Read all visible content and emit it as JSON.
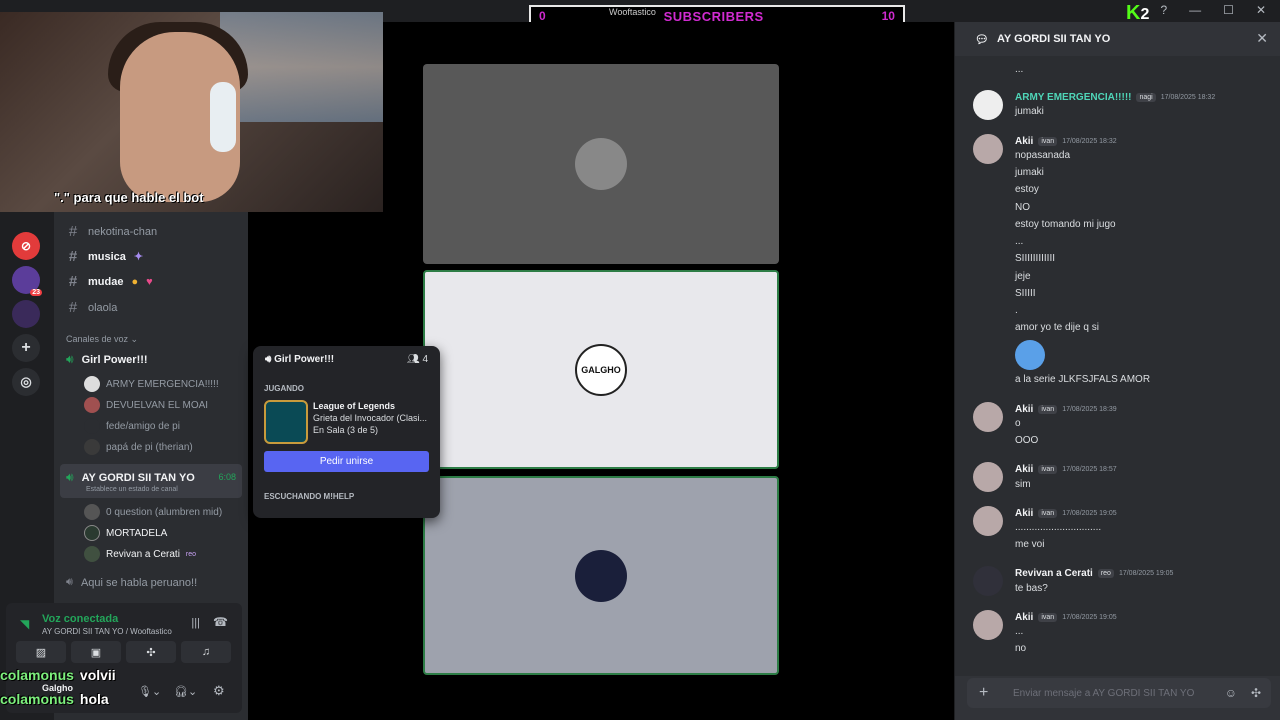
{
  "top": {
    "subs_left": "0",
    "subs_label": "SUBSCRIBERS",
    "subs_right": "10",
    "subs_user": "Wooftastico",
    "kick_count": "2"
  },
  "webcam": {
    "caption": "\".\" para que hable el bot"
  },
  "servers": [
    {
      "icon": "red-badge-icon",
      "color": "#e23b3b"
    },
    {
      "icon": "purple-server-icon",
      "color": "#5b3d9a",
      "badge": "23"
    },
    {
      "icon": "dark-server-icon",
      "color": "#3a2a5a"
    }
  ],
  "channels": [
    {
      "name": "nekotina-chan",
      "bold": false
    },
    {
      "name": "musica",
      "bold": true
    },
    {
      "name": "mudae",
      "bold": true
    },
    {
      "name": "olaola",
      "bold": false
    }
  ],
  "voice_section": "Canales de voz",
  "voice_channels": {
    "girl_power": {
      "name": "Girl Power!!!",
      "users": [
        "ARMY EMERGENCIA!!!!!",
        "DEVUELVAN EL MOAI",
        "fede/amigo de pi",
        "papá de pi (therian)"
      ]
    },
    "gordi": {
      "name": "AY GORDI SII TAN YO",
      "time": "6:08",
      "status": "Establece un estado de canal",
      "users": [
        "0 question (alumbren mid)",
        "MORTADELA",
        "Revivan a Cerati"
      ],
      "reo": "reo"
    },
    "peruano": {
      "name": "Aqui se habla peruano!!"
    }
  },
  "voice_panel": {
    "title": "Voz conectada",
    "sub": "AY GORDI SII TAN YO / Wooftastico",
    "user": "Galgho"
  },
  "chat_overlay": [
    {
      "name": "colamonus",
      "msg": "volvii"
    },
    {
      "name": "colamonus",
      "msg": "hola"
    }
  ],
  "popup": {
    "title": "Girl Power!!!",
    "count": "4",
    "playing_label": "JUGANDO",
    "game_title": "League of Legends",
    "game_mode": "Grieta del Invocador (Clasi...",
    "game_status": "En Sala (3 de 5)",
    "join_label": "Pedir unirse",
    "listening_label": "ESCUCHANDO M!HELP"
  },
  "tiles": [
    {
      "bg": "#585858",
      "avatar_label": ""
    },
    {
      "bg": "#e8e8ec",
      "avatar_label": "GALGHO"
    },
    {
      "bg": "#9ea2ad",
      "avatar_label": ""
    }
  ],
  "chat": {
    "title": "AY GORDI SII TAN YO",
    "messages_top": "...",
    "msg1": {
      "name": "ARMY EMERGENCIA!!!!!",
      "badge": "nagi",
      "time": "17/08/2025 18:32",
      "lines": [
        "jumaki"
      ]
    },
    "msg2": {
      "name": "Akii",
      "badge": "ivan",
      "time": "17/08/2025 18:32",
      "lines": [
        "nopasanada",
        "jumaki",
        "estoy",
        "NO",
        "estoy tomando mi jugo",
        "...",
        "SIIIIIIIIIIII",
        "jeje",
        "SIIIII",
        ".",
        "amor yo te dije q si"
      ],
      "after": "a la serie JLKFSJFALS AMOR"
    },
    "msg3": {
      "name": "Akii",
      "badge": "ivan",
      "time": "17/08/2025 18:39",
      "lines": [
        "o",
        "OOO"
      ]
    },
    "msg4": {
      "name": "Akii",
      "badge": "ivan",
      "time": "17/08/2025 18:57",
      "lines": [
        "sim"
      ]
    },
    "msg5": {
      "name": "Akii",
      "badge": "ivan",
      "time": "17/08/2025 19:05",
      "lines": [
        "...............................",
        "me voi"
      ]
    },
    "msg6": {
      "name": "Revivan a Cerati",
      "badge": "reo",
      "time": "17/08/2025 19:05",
      "lines": [
        "te bas?"
      ]
    },
    "msg7": {
      "name": "Akii",
      "badge": "ivan",
      "time": "17/08/2025 19:05",
      "lines": [
        "...",
        "no"
      ]
    },
    "placeholder": "Enviar mensaje a AY GORDI SII TAN YO"
  }
}
